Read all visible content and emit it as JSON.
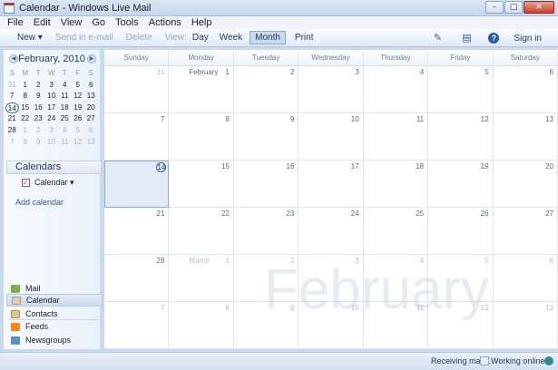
{
  "window": {
    "title": "Calendar - Windows Live Mail",
    "controls": [
      "–",
      "□",
      "✕"
    ]
  },
  "menu": [
    "File",
    "Edit",
    "View",
    "Go",
    "Tools",
    "Actions",
    "Help"
  ],
  "toolbar": {
    "new_label": "New ▾",
    "send_label": "Send in e-mail",
    "delete_label": "Delete",
    "view_label": "View:",
    "day_label": "Day",
    "week_label": "Week",
    "month_label": "Month",
    "print_label": "Print",
    "signin_label": "Sign in"
  },
  "mini_calendar": {
    "title": "February, 2010",
    "days_of_week": [
      "S",
      "M",
      "T",
      "W",
      "T",
      "F",
      "S"
    ],
    "weeks": [
      [
        "31",
        "1",
        "2",
        "3",
        "4",
        "5",
        "6"
      ],
      [
        "7",
        "8",
        "9",
        "10",
        "11",
        "12",
        "13"
      ],
      [
        "14",
        "15",
        "16",
        "17",
        "18",
        "19",
        "20"
      ],
      [
        "21",
        "22",
        "23",
        "24",
        "25",
        "26",
        "27"
      ],
      [
        "28",
        "1",
        "2",
        "3",
        "4",
        "5",
        "6"
      ],
      [
        "7",
        "8",
        "9",
        "10",
        "11",
        "12",
        "13"
      ]
    ],
    "today": "14"
  },
  "calendars": {
    "header": "Calendars",
    "items": [
      {
        "label": "Calendar ▾",
        "checked": "✓"
      }
    ],
    "add_label": "Add calendar"
  },
  "nav": [
    "Mail",
    "Calendar",
    "Contacts",
    "Feeds",
    "Newsgroups"
  ],
  "month_view": {
    "days_of_week": [
      "Sunday",
      "Monday",
      "Tuesday",
      "Wednesday",
      "Thursday",
      "Friday",
      "Saturday"
    ],
    "weeks": [
      [
        "31",
        "1",
        "2",
        "3",
        "4",
        "5",
        "6"
      ],
      [
        "7",
        "8",
        "9",
        "10",
        "11",
        "12",
        "13"
      ],
      [
        "14",
        "15",
        "16",
        "17",
        "18",
        "19",
        "20"
      ],
      [
        "21",
        "22",
        "23",
        "24",
        "25",
        "26",
        "27"
      ],
      [
        "28",
        "1",
        "2",
        "3",
        "4",
        "5",
        "6"
      ],
      [
        "7",
        "8",
        "9",
        "10",
        "11",
        "12",
        "13"
      ]
    ],
    "month_label_feb": "February",
    "month_label_mar": "March",
    "watermark": "February"
  },
  "status": {
    "receiving": "Receiving mail...",
    "online": "Working online"
  }
}
